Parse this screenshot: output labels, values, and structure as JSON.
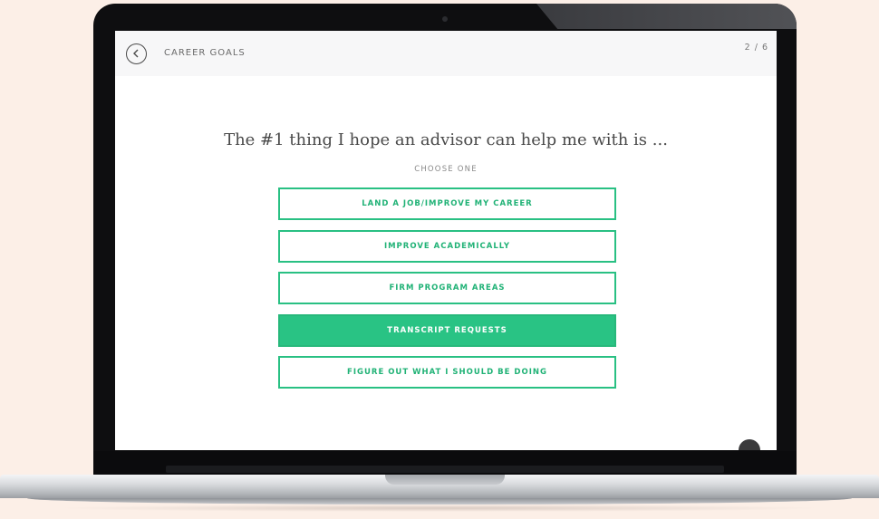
{
  "header": {
    "title": "CAREER GOALS",
    "progress": "2 / 6",
    "back_icon": "chevron-left-icon"
  },
  "question": {
    "text": "The #1 thing I hope an advisor can help me with is ...",
    "instruction": "CHOOSE ONE"
  },
  "options": [
    {
      "label": "LAND A JOB/IMPROVE MY CAREER",
      "selected": false
    },
    {
      "label": "IMPROVE ACADEMICALLY",
      "selected": false
    },
    {
      "label": "FIRM PROGRAM AREAS",
      "selected": false
    },
    {
      "label": "TRANSCRIPT REQUESTS",
      "selected": true
    },
    {
      "label": "FIGURE OUT WHAT I SHOULD BE DOING",
      "selected": false
    }
  ],
  "colors": {
    "accent": "#29c384",
    "background": "#fcefe7",
    "topbar": "#f7f7f8"
  }
}
